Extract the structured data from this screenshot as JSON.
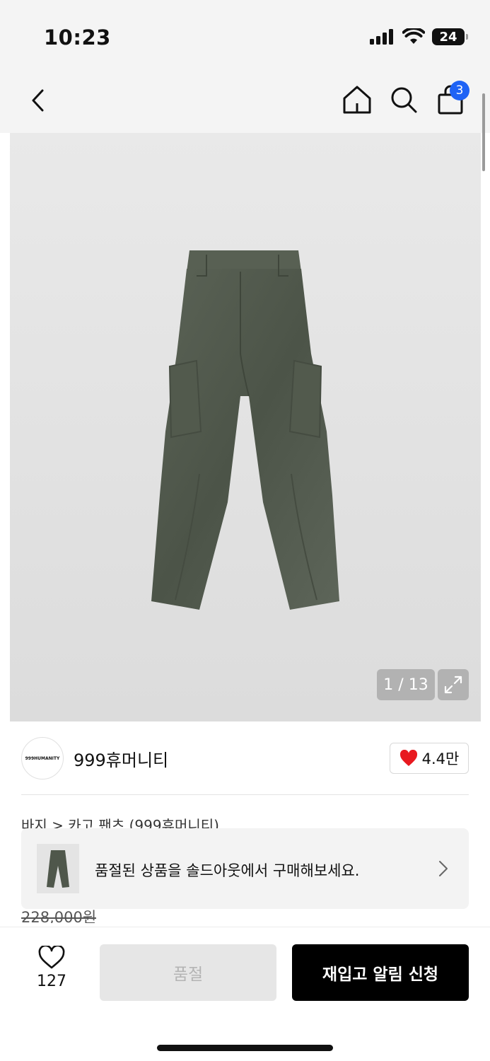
{
  "status_bar": {
    "time": "10:23",
    "battery": "24",
    "icons": [
      "signal-icon",
      "wifi-icon",
      "battery-icon"
    ]
  },
  "nav": {
    "icons": [
      "back-icon",
      "home-icon",
      "search-icon",
      "cart-icon"
    ],
    "cart_count": "3"
  },
  "gallery": {
    "counter": "1 / 13",
    "icons": [
      "expand-icon"
    ]
  },
  "brand": {
    "logo_text": "999HUMANITY",
    "name": "999휴머니티",
    "likes": "4.4만",
    "like_color": "#e8191f"
  },
  "breadcrumb": "바지 > 카고 팬츠 (999휴머니티)",
  "banner": {
    "text": "품절된 상품을 솔드아웃에서 구매해보세요."
  },
  "price": {
    "original": "228,000원"
  },
  "actions": {
    "wish_count": "127",
    "soldout_label": "품절",
    "restock_label": "재입고 알림 신청"
  },
  "colors": {
    "badge": "#1f63f5",
    "primary_button": "#000000",
    "disabled_button": "#e6e6e6"
  }
}
